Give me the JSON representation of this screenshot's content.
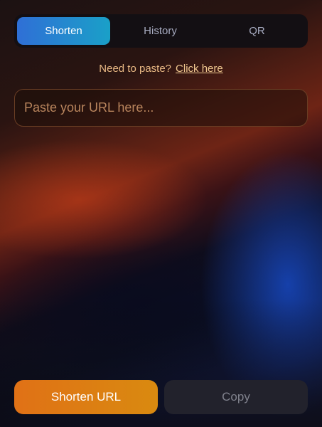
{
  "tabs": {
    "items": [
      {
        "label": "Shorten",
        "active": true
      },
      {
        "label": "History",
        "active": false
      },
      {
        "label": "QR",
        "active": false
      }
    ]
  },
  "paste_hint": {
    "text": "Need to paste?",
    "link_label": "Click here"
  },
  "url_input": {
    "placeholder": "Paste your URL here...",
    "value": ""
  },
  "actions": {
    "shorten_label": "Shorten URL",
    "copy_label": "Copy"
  },
  "colors": {
    "active_tab_start": "#2f6fd6",
    "active_tab_end": "#1aa0c8",
    "shorten_button": "#e07116",
    "copy_button": "#22222c",
    "hint_text": "#e8b884"
  }
}
